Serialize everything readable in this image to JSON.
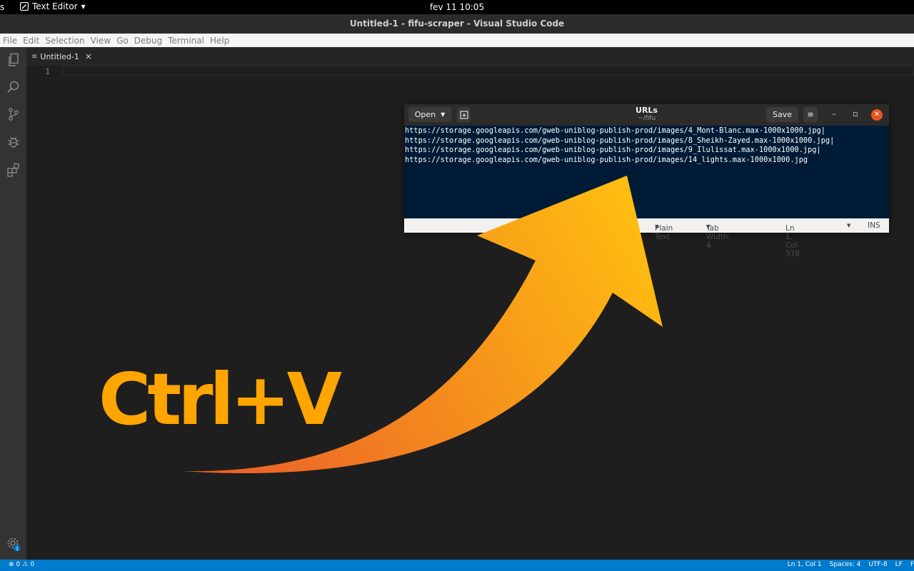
{
  "topbar": {
    "activities_label": "s",
    "app_name": "Text Editor",
    "app_arrow": "▾",
    "clock": "fev 11  10:05"
  },
  "window": {
    "title": "Untitled-1 - fifu-scraper - Visual Studio Code"
  },
  "menu": {
    "file": "File",
    "edit": "Edit",
    "selection": "Selection",
    "view": "View",
    "go": "Go",
    "debug": "Debug",
    "terminal": "Terminal",
    "help": "Help"
  },
  "activitybar": {
    "icons": [
      "files-icon",
      "search-icon",
      "source-control-icon",
      "debug-icon",
      "extensions-icon",
      "settings-gear-icon"
    ],
    "settings_badge": "1"
  },
  "tabs": [
    {
      "label": "Untitled-1",
      "close": "×"
    }
  ],
  "editor": {
    "line_number": "1"
  },
  "statusbar": {
    "errors": "0",
    "warnings": "0",
    "position": "Ln 1, Col 1",
    "spaces": "Spaces: 4",
    "encoding": "UTF-8",
    "eol": "LF",
    "language": "F"
  },
  "gedit": {
    "open_label": "Open",
    "save_label": "Save",
    "title": "URLs",
    "subtitle": "~/fifu",
    "lines": [
      "https://storage.googleapis.com/gweb-uniblog-publish-prod/images/4_Mont-Blanc.max-1000x1000.jpg|",
      "https://storage.googleapis.com/gweb-uniblog-publish-prod/images/8_Sheikh-Zayed.max-1000x1000.jpg|",
      "https://storage.googleapis.com/gweb-uniblog-publish-prod/images/9_Ilulissat.max-1000x1000.jpg|",
      "https://storage.googleapis.com/gweb-uniblog-publish-prod/images/14_lights.max-1000x1000.jpg"
    ],
    "status": {
      "language": "Plain Text",
      "tab_width": "Tab Width: 4",
      "position": "Ln 1, Col 378",
      "mode": "INS"
    }
  },
  "overlay": {
    "shortcut": "Ctrl+V",
    "colors": {
      "arrow_start": "#ea5a2a",
      "arrow_end": "#ffc010",
      "text": "#ffa500"
    }
  }
}
